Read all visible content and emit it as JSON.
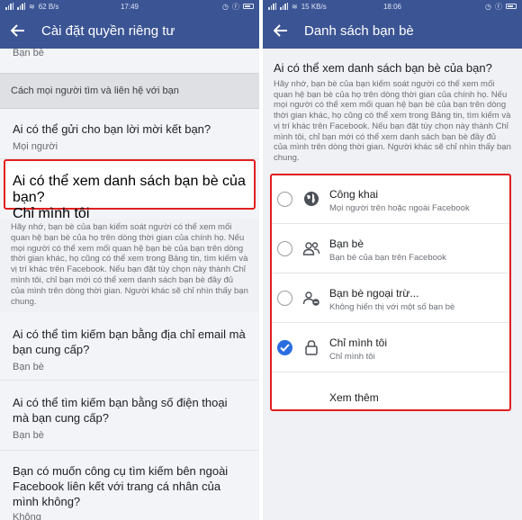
{
  "left": {
    "status": {
      "left": "62 B/s",
      "time": "17:49"
    },
    "appbar": {
      "title": "Cài đặt quyền riêng tư"
    },
    "top_partial_value": "Bạn bè",
    "section_header": "Cách mọi người tìm và liên hệ với bạn",
    "rows": [
      {
        "question": "Ai có thể gửi cho bạn lời mời kết bạn?",
        "answer": "Mọi người"
      },
      {
        "question": "Ai có thể xem danh sách bạn bè của bạn?",
        "answer": "Chỉ mình tôi"
      },
      {
        "question": "Ai có thể tìm kiếm bạn bằng địa chỉ email mà bạn cung cấp?",
        "answer": "Bạn bè"
      },
      {
        "question": "Ai có thể tìm kiếm bạn bằng số điện thoại mà bạn cung cấp?",
        "answer": "Bạn bè"
      },
      {
        "question": "Bạn có muốn công cụ tìm kiếm bên ngoài Facebook liên kết với trang cá nhân của mình không?",
        "answer": "Không"
      }
    ],
    "note": "Hãy nhớ, bạn bè của bạn kiểm soát người có thể xem mối quan hệ bạn bè của họ trên dòng thời gian của chính họ. Nếu mọi người có thể xem mối quan hệ bạn bè của bạn trên dòng thời gian khác, họ cũng có thể xem trong Bảng tin, tìm kiếm và vị trí khác trên Facebook. Nếu bạn đặt tùy chọn này thành Chỉ mình tôi, chỉ bạn mới có thể xem danh sách bạn bè đầy đủ của mình trên dòng thời gian. Người khác sẽ chỉ nhìn thấy bạn chung."
  },
  "right": {
    "status": {
      "left": "15 KB/s",
      "time": "18:06"
    },
    "appbar": {
      "title": "Danh sách bạn bè"
    },
    "heading": "Ai có thể xem danh sách bạn bè của bạn?",
    "description": "Hãy nhớ, bạn bè của bạn kiểm soát người có thể xem mối quan hệ bạn bè của họ trên dòng thời gian của chính họ. Nếu mọi người có thể xem mối quan hệ bạn bè của bạn trên dòng thời gian khác, họ cũng có thể xem trong Bảng tin, tìm kiếm và vị trí khác trên Facebook. Nếu bạn đặt tùy chọn này thành Chỉ mình tôi, chỉ bạn mới có thể xem danh sách bạn bè đầy đủ của mình trên dòng thời gian. Người khác sẽ chỉ nhìn thấy bạn chung.",
    "options": [
      {
        "label": "Công khai",
        "sub": "Mọi người trên hoặc ngoài Facebook",
        "icon": "globe-icon",
        "checked": false
      },
      {
        "label": "Bạn bè",
        "sub": "Bạn bè của bạn trên Facebook",
        "icon": "friends-icon",
        "checked": false
      },
      {
        "label": "Bạn bè ngoại trừ...",
        "sub": "Không hiển thị với một số bạn bè",
        "icon": "friends-except-icon",
        "checked": false
      },
      {
        "label": "Chỉ mình tôi",
        "sub": "Chỉ mình tôi",
        "icon": "lock-icon",
        "checked": true
      }
    ],
    "see_more": "Xem thêm"
  },
  "colors": {
    "brand": "#3b5494",
    "highlight": "#e02020",
    "radio_checked": "#2a6de0"
  }
}
